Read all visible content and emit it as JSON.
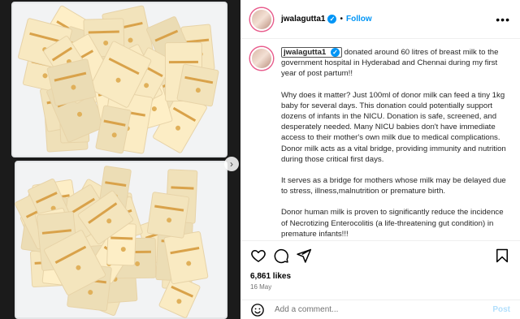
{
  "post": {
    "username": "jwalagutta1",
    "follow_label": "Follow",
    "separator": "•",
    "more_label": "•••"
  },
  "caption": {
    "mention": "jwalagutta1",
    "lead": " donated around 60 litres of breast milk to the government hospital in Hyderabad and Chennai during my first year of post partum!!",
    "para2": "Why does it matter? Just 100ml of donor milk can feed a tiny 1kg baby for several days. This donation could potentially support dozens of infants in the NICU. Donation is safe, screened, and desperately needed. Many NICU babies don't have immediate access to their mother's own milk due to medical complications. Donor milk acts as a vital bridge, providing immunity and nutrition during those critical first days.",
    "para3": "It serves as a bridge for mothers whose milk may be delayed due to stress, illness,malnutrition or premature birth.",
    "para4": "Donor human milk is proven to significantly reduce the incidence of Necrotizing Enterocolitis (a life-threatening gut condition) in premature infants!!!"
  },
  "stats": {
    "likes": "6,861 likes",
    "date": "16 May"
  },
  "comment": {
    "placeholder": "Add a comment...",
    "post_label": "Post"
  },
  "icons": {
    "like": "heart-icon",
    "comment": "comment-icon",
    "share": "share-icon",
    "save": "bookmark-icon",
    "emoji": "emoji-icon",
    "verified": "verified-badge-icon",
    "next": "chevron-right-icon"
  },
  "colors": {
    "accent": "#0095f6",
    "post_disabled": "#b2dffc",
    "muted": "#737373"
  }
}
